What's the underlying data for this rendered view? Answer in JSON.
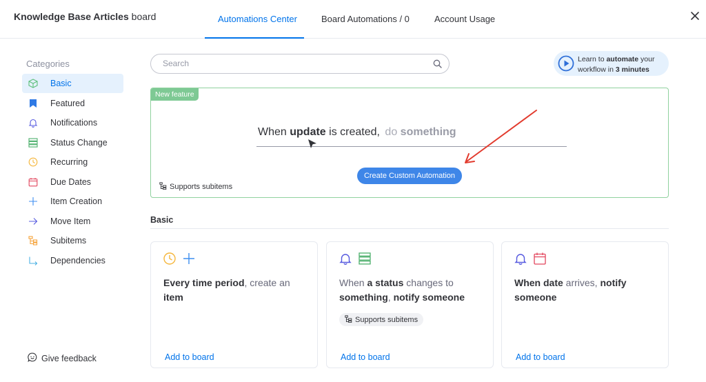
{
  "header": {
    "board_name": "Knowledge Base Articles",
    "board_suffix": "board",
    "tabs": [
      {
        "label": "Automations Center",
        "active": true
      },
      {
        "label": "Board Automations / 0",
        "active": false
      },
      {
        "label": "Account Usage",
        "active": false
      }
    ]
  },
  "sidebar": {
    "title": "Categories",
    "items": [
      {
        "label": "Basic",
        "icon": "cube-icon"
      },
      {
        "label": "Featured",
        "icon": "bookmark-icon"
      },
      {
        "label": "Notifications",
        "icon": "bell-icon"
      },
      {
        "label": "Status Change",
        "icon": "status-icon"
      },
      {
        "label": "Recurring",
        "icon": "clock-icon"
      },
      {
        "label": "Due Dates",
        "icon": "calendar-icon"
      },
      {
        "label": "Item Creation",
        "icon": "plus-icon"
      },
      {
        "label": "Move Item",
        "icon": "arrow-right-icon"
      },
      {
        "label": "Subitems",
        "icon": "subitems-icon"
      },
      {
        "label": "Dependencies",
        "icon": "dependencies-icon"
      }
    ],
    "feedback": "Give feedback"
  },
  "search": {
    "placeholder": "Search"
  },
  "learn": {
    "pre": "Learn to ",
    "bold1": "automate",
    "mid": " your",
    "line2": "workflow in ",
    "bold2": "3 minutes"
  },
  "feature": {
    "badge": "New feature",
    "when": "When ",
    "update": "update",
    "created": " is created,",
    "do": "do ",
    "something": "something",
    "button": "Create Custom Automation",
    "supports": "Supports subitems"
  },
  "section": {
    "title": "Basic"
  },
  "cards": [
    {
      "p1": "Every time period",
      "p2": ", create an ",
      "p3": "item",
      "add": "Add to board"
    },
    {
      "p1": "When ",
      "p2": "a status",
      "p3": " changes to ",
      "p4": "something",
      "p5": ", ",
      "p6": "notify someone",
      "chip": "Supports subitems",
      "add": "Add to board"
    },
    {
      "p1": "When date",
      "p2": " arrives, ",
      "p3": "notify",
      "p4": " someone",
      "add": "Add to board"
    }
  ],
  "colors": {
    "accent": "#0073ea",
    "button": "#3e86e8",
    "feature_border": "#8fd19e",
    "annotation_arrow": "#e23b2e"
  }
}
